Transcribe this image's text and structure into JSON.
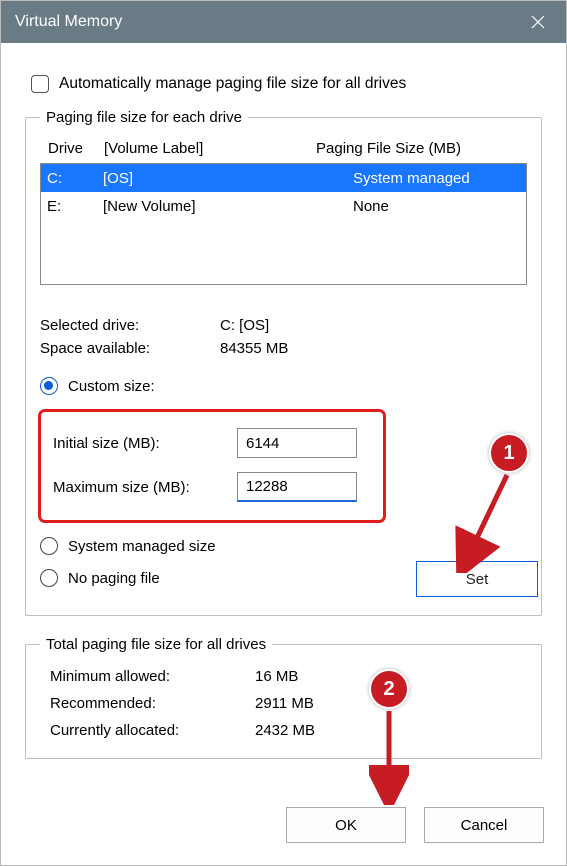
{
  "window": {
    "title": "Virtual Memory"
  },
  "auto_cb": {
    "label": "Automatically manage paging file size for all drives"
  },
  "group1": {
    "legend": "Paging file size for each drive",
    "headers": {
      "drive": "Drive",
      "label": "[Volume Label]",
      "size": "Paging File Size (MB)"
    },
    "rows": [
      {
        "drive": "C:",
        "label": "[OS]",
        "size": "System managed",
        "selected": true
      },
      {
        "drive": "E:",
        "label": "[New Volume]",
        "size": "None",
        "selected": false
      }
    ],
    "selected_drive_lbl": "Selected drive:",
    "selected_drive_val": "C:  [OS]",
    "space_lbl": "Space available:",
    "space_val": "84355 MB",
    "radio_custom": "Custom size:",
    "initial_lbl": "Initial size (MB):",
    "initial_val": "6144",
    "max_lbl": "Maximum size (MB):",
    "max_val": "12288",
    "radio_sys": "System managed size",
    "radio_none": "No paging file",
    "set_btn": "Set"
  },
  "group2": {
    "legend": "Total paging file size for all drives",
    "min_lbl": "Minimum allowed:",
    "min_val": "16 MB",
    "rec_lbl": "Recommended:",
    "rec_val": "2911 MB",
    "cur_lbl": "Currently allocated:",
    "cur_val": "2432 MB"
  },
  "buttons": {
    "ok": "OK",
    "cancel": "Cancel"
  },
  "annotations": {
    "b1": "1",
    "b2": "2"
  }
}
